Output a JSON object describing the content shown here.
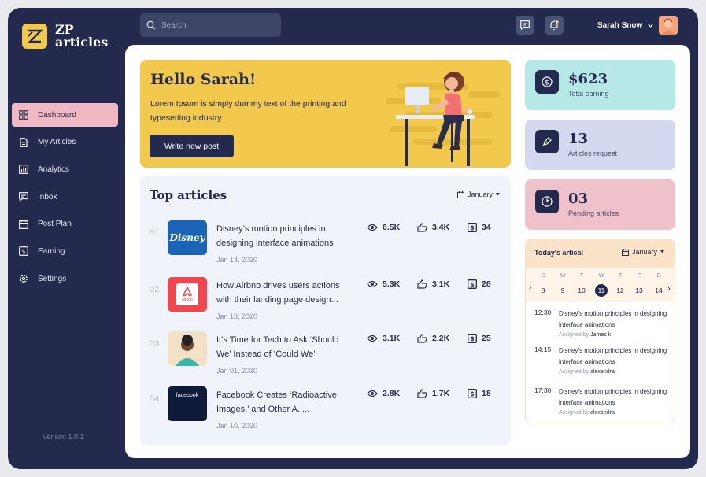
{
  "brand": {
    "line1": "ZP",
    "line2": "articles"
  },
  "sidebar": {
    "items": [
      {
        "label": "Dashboard",
        "icon": "dashboard-icon",
        "active": true
      },
      {
        "label": "My Articles",
        "icon": "document-icon"
      },
      {
        "label": "Analytics",
        "icon": "chart-icon"
      },
      {
        "label": "Inbox",
        "icon": "inbox-icon"
      },
      {
        "label": "Post Plan",
        "icon": "calendar-icon"
      },
      {
        "label": "Earning",
        "icon": "dollar-icon"
      },
      {
        "label": "Settings",
        "icon": "gear-icon"
      }
    ],
    "version": "Verison 1.0.1"
  },
  "topbar": {
    "search_placeholder": "Search",
    "user_name": "Sarah Snow"
  },
  "hero": {
    "greeting": "Hello Sarah!",
    "text": "Lorem Ipsum is simply dummy text of the printing and typesetting industry.",
    "button": "Write new post"
  },
  "top_articles": {
    "title": "Top articles",
    "month": "January",
    "items": [
      {
        "num": "01",
        "brand": "Disney",
        "title": "Disney’s motion principles in designing interface animations",
        "date": "Jan 13, 2020",
        "views": "6.5K",
        "likes": "3.4K",
        "earning": "34"
      },
      {
        "num": "02",
        "brand": "airbnb",
        "title": "How Airbnb drives users actions with their landing page design...",
        "date": "Jan 13, 2020",
        "views": "5.3K",
        "likes": "3.1K",
        "earning": "28"
      },
      {
        "num": "03",
        "brand": "",
        "title": "It’s Time for Tech to Ask ‘Should We’ Instead of ‘Could We’",
        "date": "Jan 01, 2020",
        "views": "3.1K",
        "likes": "2.2K",
        "earning": "25"
      },
      {
        "num": "04",
        "brand": "facebook",
        "title": "Facebook Creates ‘Radioactive Images,’ and Other A.I...",
        "date": "Jan 10, 2020",
        "views": "2.8K",
        "likes": "1.7K",
        "earning": "18"
      }
    ]
  },
  "cards": [
    {
      "value": "$623",
      "label": "Total earning",
      "color": "#b6e8e8",
      "icon": "dollar-icon"
    },
    {
      "value": "13",
      "label": "Articles request",
      "color": "#d5d9f0",
      "icon": "pen-icon"
    },
    {
      "value": "03",
      "label": "Pending articles",
      "color": "#efc1cb",
      "icon": "clock-icon"
    }
  ],
  "today": {
    "title": "Today's artical",
    "month": "January",
    "weekdays": [
      "S",
      "M",
      "T",
      "W",
      "T",
      "F",
      "S"
    ],
    "days": [
      "8",
      "9",
      "10",
      "11",
      "12",
      "13",
      "14"
    ],
    "selected_index": 3,
    "events": [
      {
        "time": "12:30",
        "title": "Disney’s motion principles in designing interface animations",
        "assigned_label": "Assigned by",
        "assignee": "James k"
      },
      {
        "time": "14:15",
        "title": "Disney’s motion principles in designing interface animations",
        "assigned_label": "Assigned by",
        "assignee": "alexandra"
      },
      {
        "time": "17:30",
        "title": "Disney’s motion principles in designing interface animations",
        "assigned_label": "Assigned by",
        "assignee": "alexandra"
      }
    ]
  },
  "colors": {
    "navy": "#232a4d",
    "yellow": "#f2c94c",
    "pink": "#efb8c3"
  }
}
